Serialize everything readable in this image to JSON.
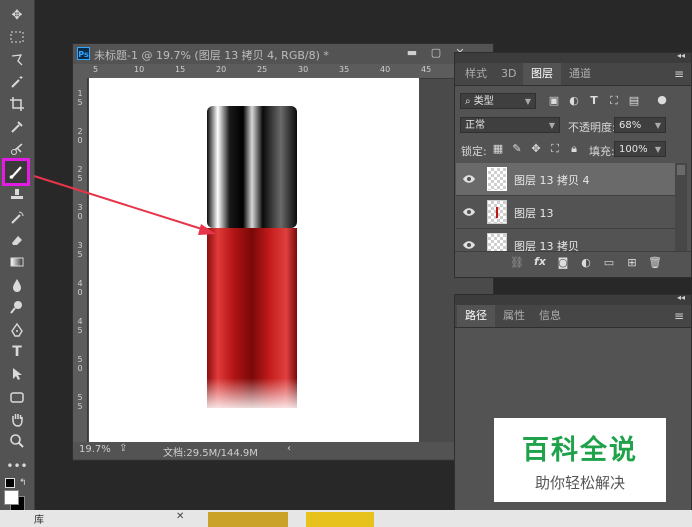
{
  "document": {
    "ps_badge": "Ps",
    "title": "未标题-1 @ 19.7% (图层 13 拷贝 4, RGB/8) *",
    "ruler_top": [
      "5",
      "10",
      "15",
      "20",
      "25",
      "30",
      "35",
      "40",
      "45"
    ],
    "ruler_left": [
      "1",
      "5",
      "2",
      "0",
      "2",
      "5",
      "3",
      "0",
      "3",
      "5",
      "4",
      "0",
      "4",
      "5",
      "5",
      "0",
      "5",
      "5"
    ],
    "status": {
      "zoom": "19.7%",
      "doc_size": "文档:29.5M/144.9M",
      "nav_left": "‹",
      "nav_right": "›"
    }
  },
  "layers_panel": {
    "tabs": [
      "样式",
      "3D",
      "图层",
      "通道"
    ],
    "active_tab": "图层",
    "filter_label": "类型",
    "blend_mode": "正常",
    "opacity_label": "不透明度:",
    "opacity_value": "68%",
    "lock_label": "锁定:",
    "fill_label": "填充:",
    "fill_value": "100%",
    "layers": [
      {
        "name": "图层 13 拷贝 4",
        "selected": true
      },
      {
        "name": "图层 13",
        "selected": false
      },
      {
        "name": "图层 13 拷贝",
        "selected": false
      }
    ],
    "bottom_fx": "fx"
  },
  "properties_panel": {
    "tabs": [
      "路径",
      "属性",
      "信息"
    ],
    "active_tab": "路径"
  },
  "watermark": {
    "title": "百科全说",
    "subtitle": "助你轻松解决"
  },
  "taskbar": {
    "item": "库"
  },
  "colors": {
    "highlight": "#e31be3",
    "arrow": "#e8344a",
    "lipstick_red": "#c01818",
    "watermark_green": "#1fa24a"
  }
}
